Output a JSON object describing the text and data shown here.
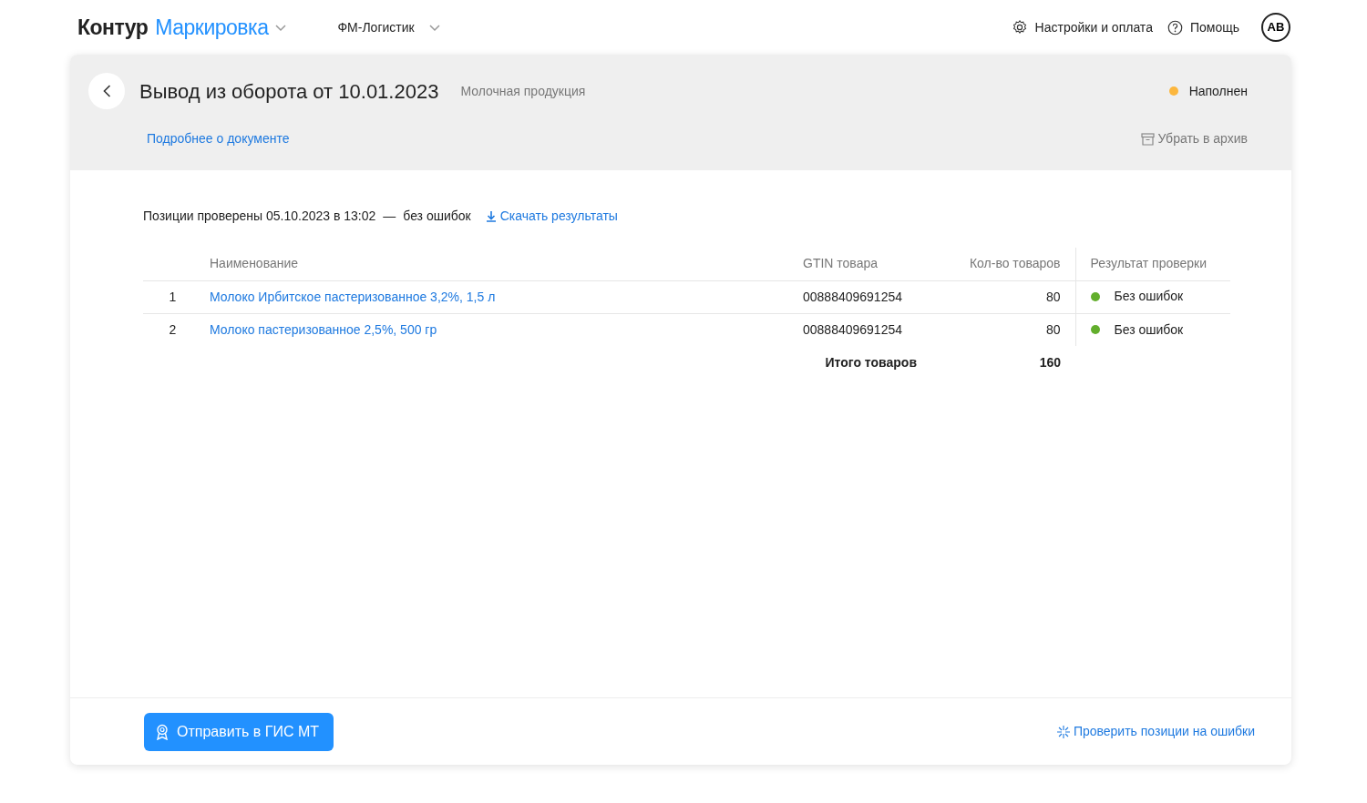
{
  "header": {
    "logo_brand": "Контур",
    "logo_product": "Маркировка",
    "organization": "ФМ-Логистик",
    "settings": "Настройки и оплата",
    "help": "Помощь",
    "avatar": "АВ"
  },
  "document": {
    "title": "Вывод из оборота от 10.01.2023",
    "category": "Молочная продукция",
    "status": {
      "label": "Наполнен",
      "color": "#fcb73e"
    },
    "details_link": "Подробнее о документе",
    "archive": "Убрать в архив"
  },
  "check_summary": {
    "text": "Позиции проверены 05.10.2023 в 13:02",
    "separator": "—",
    "result": "без ошибок",
    "download": "Скачать результаты"
  },
  "table": {
    "columns": [
      "Наименование",
      "GTIN товара",
      "Кол-во товаров",
      "Результат проверки"
    ],
    "rows": [
      {
        "number": "1",
        "name": "Молоко Ирбитское пастеризованное  3,2%, 1,5 л",
        "gtin": "00888409691254",
        "quantity": "80",
        "result": "Без ошибок",
        "color": "#62ae2c"
      },
      {
        "number": "2",
        "name": "Молоко пастеризованное 2,5%, 500 гр",
        "gtin": "00888409691254",
        "quantity": "80",
        "result": "Без ошибок",
        "color": "#62ae2c"
      }
    ],
    "total_label": "Итого товаров",
    "total_value": "160"
  },
  "footer": {
    "send_button": "Отправить в ГИС МТ",
    "check_link": "Проверить позиции на ошибки"
  }
}
